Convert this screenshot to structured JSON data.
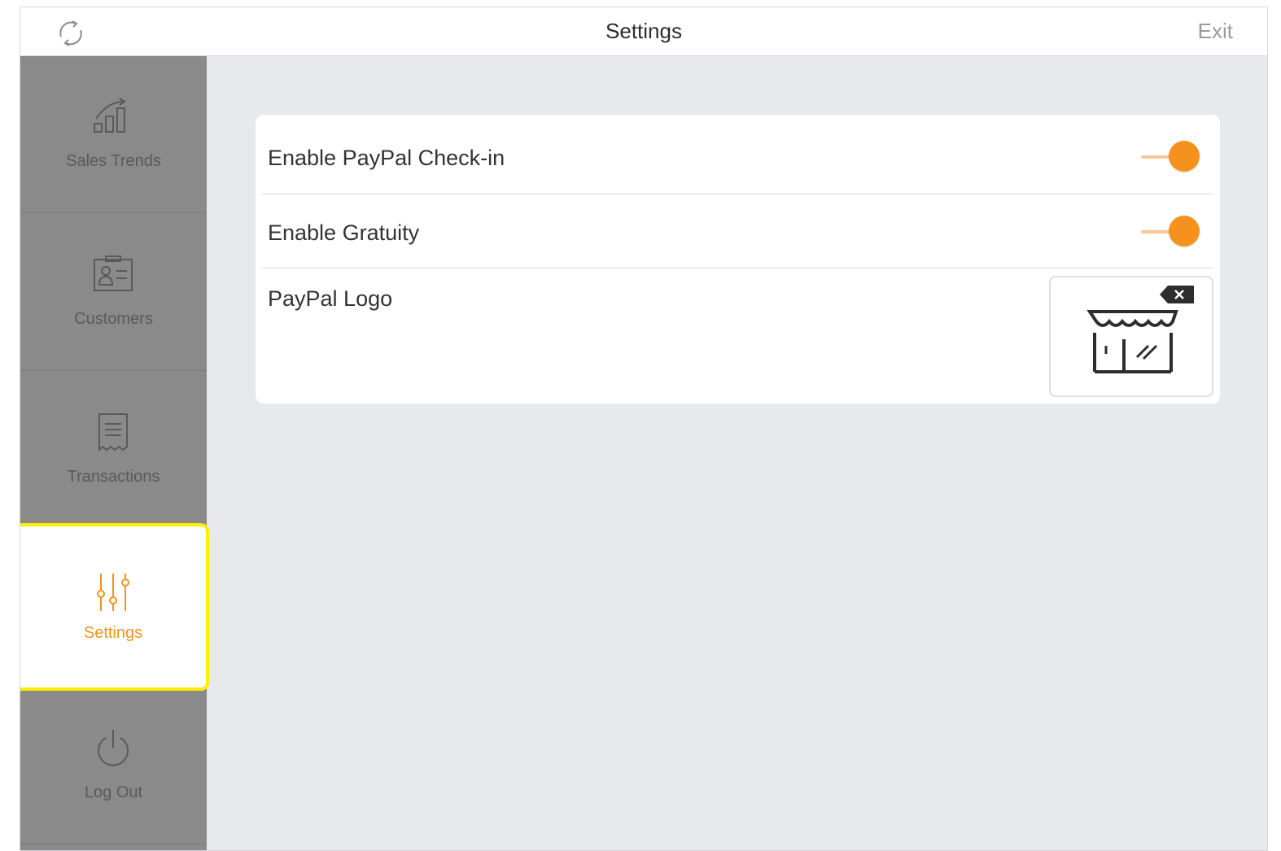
{
  "header": {
    "title": "Settings",
    "exit_label": "Exit",
    "refresh_icon": "refresh-icon"
  },
  "sidebar": {
    "items": [
      {
        "label": "Sales Trends",
        "icon": "sales-trends-icon",
        "active": false
      },
      {
        "label": "Customers",
        "icon": "customers-icon",
        "active": false
      },
      {
        "label": "Transactions",
        "icon": "receipt-icon",
        "active": false
      },
      {
        "label": "Settings",
        "icon": "sliders-icon",
        "active": true
      },
      {
        "label": "Log Out",
        "icon": "power-icon",
        "active": false
      }
    ]
  },
  "settings": {
    "checkin": {
      "label": "Enable PayPal Check-in",
      "enabled": true
    },
    "gratuity": {
      "label": "Enable Gratuity",
      "enabled": true
    },
    "logo": {
      "label": "PayPal Logo",
      "icon": "store-icon",
      "remove_icon": "remove-icon"
    }
  },
  "colors": {
    "accent": "#f5921e",
    "sidebar_bg": "#8a8a8a",
    "highlight": "#ffee00",
    "content_bg": "#e8e9ed"
  }
}
